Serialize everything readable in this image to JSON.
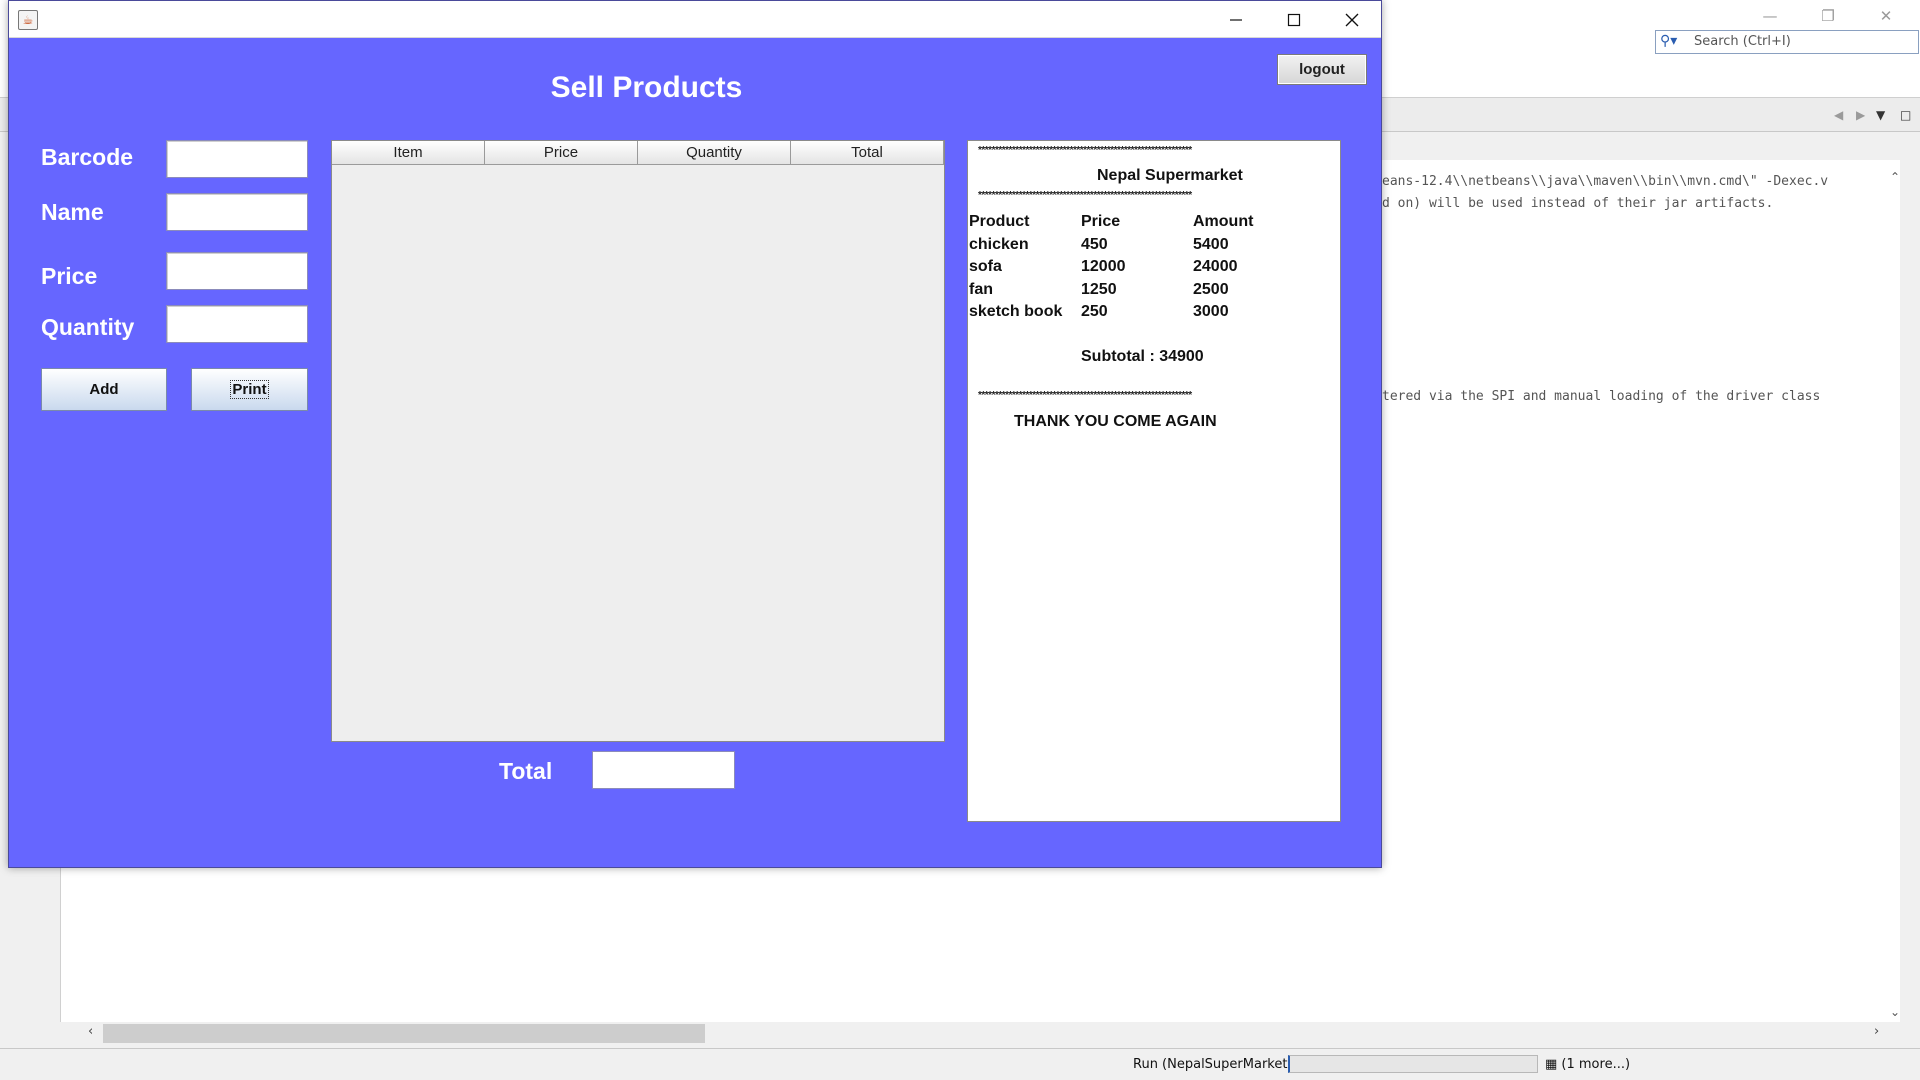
{
  "ide": {
    "search_placeholder": "Search (Ctrl+I)",
    "output_lines": [
      "eans-12.4\\\\netbeans\\\\java\\\\maven\\\\bin\\\\mvn.cmd\\\" -Dexec.v",
      "d on) will be used instead of their jar artifacts.",
      "tered via the SPI and manual loading of the driver class"
    ],
    "status_run": "Run (NepalSuperMarket)",
    "status_more": "(1 more...)"
  },
  "window": {
    "heading": "Sell Products",
    "logout_label": "logout",
    "fields": {
      "barcode_label": "Barcode",
      "name_label": "Name",
      "price_label": "Price",
      "quantity_label": "Quantity"
    },
    "add_label": "Add",
    "print_label": "Print",
    "table_columns": [
      "Item",
      "Price",
      "Quantity",
      "Total"
    ],
    "total_label": "Total"
  },
  "receipt": {
    "stars": "***************************************************************",
    "store_name": "Nepal Supermarket",
    "headers": [
      "Product",
      "Price",
      "Amount"
    ],
    "rows": [
      [
        "chicken",
        "450",
        "5400"
      ],
      [
        "sofa",
        "12000",
        "24000"
      ],
      [
        "fan",
        "1250",
        "2500"
      ],
      [
        "sketch book",
        "250",
        "3000"
      ]
    ],
    "subtotal": "Subtotal : 34900",
    "footer": "THANK YOU COME AGAIN"
  }
}
